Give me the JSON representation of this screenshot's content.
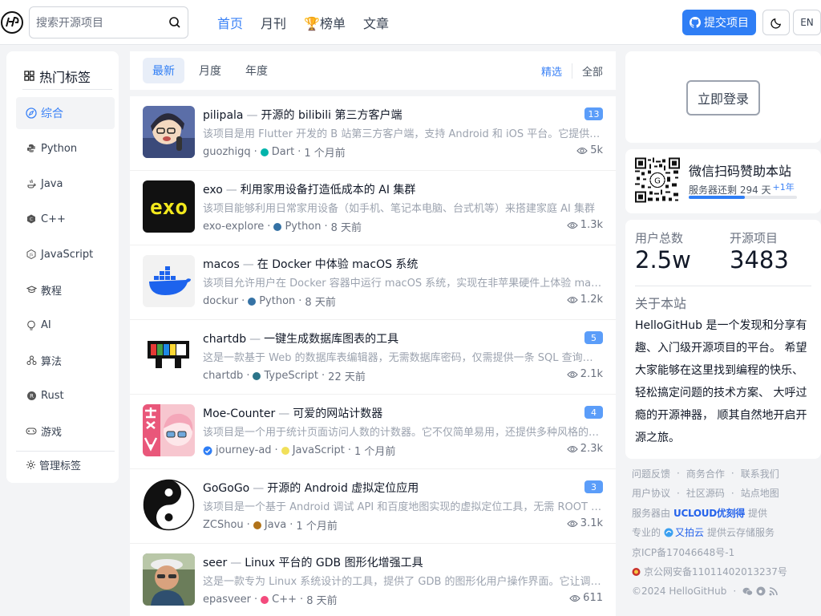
{
  "header": {
    "search_placeholder": "搜索开源项目",
    "nav": [
      "首页",
      "月刊",
      "榜单",
      "文章"
    ],
    "submit_label": "提交项目",
    "lang_label": "EN"
  },
  "sidebar": {
    "title": "热门标签",
    "tags": [
      "综合",
      "Python",
      "Java",
      "C++",
      "JavaScript",
      "教程",
      "AI",
      "算法",
      "Rust",
      "游戏"
    ],
    "manage_label": "管理标签"
  },
  "tabs": {
    "items": [
      "最新",
      "月度",
      "年度"
    ],
    "right": [
      "精选",
      "全部"
    ]
  },
  "projects": [
    {
      "name": "pilipala",
      "title": "开源的 bilibili 第三方客户端",
      "badge": "13",
      "desc": "该项目是用 Flutter 开发的 B 站第三方客户端，支持 Android 和 iOS 平台。它提供了推荐视频、热门推荐、视频搜索、视频播放等功能",
      "author": "guozhigq",
      "lang": "Dart",
      "lang_color": "#00b4ab",
      "time": "1 个月前",
      "views": "5k",
      "verified": false
    },
    {
      "name": "exo",
      "title": "利用家用设备打造低成本的 AI 集群",
      "badge": "",
      "desc": "该项目能够利用日常家用设备（如手机、笔记本电脑、台式机等）来搭建家庭 AI 集群",
      "author": "exo-explore",
      "lang": "Python",
      "lang_color": "#3572a5",
      "time": "8 天前",
      "views": "1.3k",
      "verified": false
    },
    {
      "name": "macos",
      "title": "在 Docker 中体验 macOS 系统",
      "badge": "",
      "desc": "该项目允许用户在 Docker 容器中运行 macOS 系统，实现在非苹果硬件上体验 macOS",
      "author": "dockur",
      "lang": "Python",
      "lang_color": "#3572a5",
      "time": "8 天前",
      "views": "1.2k",
      "verified": false
    },
    {
      "name": "chartdb",
      "title": "一键生成数据库图表的工具",
      "badge": "5",
      "desc": "这是一款基于 Web 的数据库表编辑器，无需数据库密码，仅需提供一条 SQL 查询语句",
      "author": "chartdb",
      "lang": "TypeScript",
      "lang_color": "#2b7489",
      "time": "22 天前",
      "views": "2.1k",
      "verified": false
    },
    {
      "name": "Moe-Counter",
      "title": "可爱的网站计数器",
      "badge": "4",
      "desc": "该项目是一个用于统计页面访问人数的计数器。它不仅简单易用，还提供多种风格的主题",
      "author": "journey-ad",
      "lang": "JavaScript",
      "lang_color": "#f1e05a",
      "time": "1 个月前",
      "views": "2.3k",
      "verified": true
    },
    {
      "name": "GoGoGo",
      "title": "开源的 Android 虚拟定位应用",
      "badge": "3",
      "desc": "该项目是一个基于 Android 调试 API 和百度地图实现的虚拟定位工具，无需 ROOT 权限",
      "author": "ZCShou",
      "lang": "Java",
      "lang_color": "#b07219",
      "time": "1 个月前",
      "views": "3.1k",
      "verified": false
    },
    {
      "name": "seer",
      "title": "Linux 平台的 GDB 图形化增强工具",
      "badge": "",
      "desc": "这是一款专为 Linux 系统设计的工具，提供了 GDB 的图形化用户操作界面。它让调试更加直观",
      "author": "epasveer",
      "lang": "C++",
      "lang_color": "#f34b7d",
      "time": "8 天前",
      "views": "611",
      "verified": false
    }
  ],
  "login_label": "立即登录",
  "sponsor": {
    "title": "微信扫码赞助本站",
    "sub": "服务器还剩 294 天",
    "plus": "+1年",
    "progress": 0.52
  },
  "stats": {
    "users_label": "用户总数",
    "users_value": "2.5w",
    "projects_label": "开源项目",
    "projects_value": "3483",
    "about_title": "关于本站",
    "about_text": "HelloGitHub 是一个发现和分享有趣、入门级开源项目的平台。 希望大家能够在这里找到编程的快乐、 轻松搞定问题的技术方案、 大呼过瘾的开源神器， 顺其自然地开启开源之旅。"
  },
  "footer": {
    "links1": [
      "问题反馈",
      "商务合作",
      "联系我们"
    ],
    "links2": [
      "用户协议",
      "社区源码",
      "站点地图"
    ],
    "server_prefix": "服务器由",
    "server_brand": "UCLOUD优刻得",
    "server_suffix": "提供",
    "cdn_prefix": "专业的",
    "cdn_brand": "又拍云",
    "cdn_suffix": "提供云存储服务",
    "icp": "京ICP备17046648号-1",
    "police": "京公网安备11011402013237号",
    "copyright": "©2024 HelloGitHub"
  }
}
